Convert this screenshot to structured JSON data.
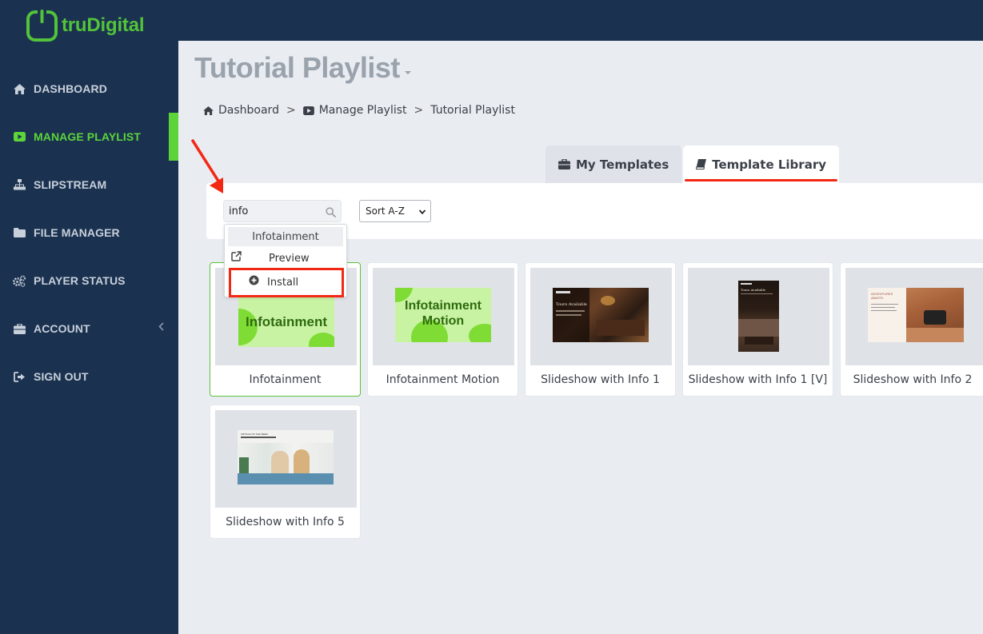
{
  "brand": {
    "logo_text": "truDigital",
    "accent_color": "#5cd43a",
    "sidebar_bg": "#1a3150"
  },
  "sidebar": {
    "items": [
      {
        "label": "DASHBOARD",
        "icon": "home-icon"
      },
      {
        "label": "MANAGE PLAYLIST",
        "icon": "play-icon",
        "active": true
      },
      {
        "label": "SLIPSTREAM",
        "icon": "sitemap-icon"
      },
      {
        "label": "FILE MANAGER",
        "icon": "folder-icon"
      },
      {
        "label": "PLAYER STATUS",
        "icon": "gears-icon"
      },
      {
        "label": "ACCOUNT",
        "icon": "briefcase-icon"
      },
      {
        "label": "SIGN OUT",
        "icon": "sign-out-icon"
      }
    ]
  },
  "page": {
    "title": "Tutorial Playlist"
  },
  "breadcrumb": {
    "home": "Dashboard",
    "playlist": "Manage Playlist",
    "current": "Tutorial Playlist"
  },
  "tabs": {
    "my_templates": "My Templates",
    "template_library": "Template Library",
    "active": "Template Library"
  },
  "filter": {
    "search_value": "info",
    "sort_value": "Sort A-Z"
  },
  "popup": {
    "header": "Infotainment",
    "preview": "Preview",
    "install": "Install"
  },
  "cards": [
    {
      "title": "Infotainment",
      "thumb_text": "Infotainment",
      "selected": true
    },
    {
      "title": "Infotainment Motion",
      "thumb_text_1": "Infotainment",
      "thumb_text_2": "Motion"
    },
    {
      "title": "Slideshow with Info 1",
      "thumb_text": "Tours Available"
    },
    {
      "title": "Slideshow with Info 1 [V]",
      "thumb_text": "Tours Available"
    },
    {
      "title": "Slideshow with Info 2",
      "thumb_text": "ADVENTURES AWAITS"
    },
    {
      "title": "Slideshow with Info 5",
      "thumb_text": "ARTICLE OF THE WEEK"
    }
  ]
}
